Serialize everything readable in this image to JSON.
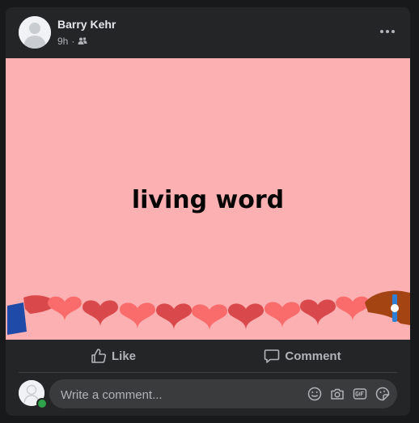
{
  "post": {
    "author": "Barry Kehr",
    "time": "9h",
    "separator": "·",
    "audience_icon": "friends-icon",
    "more_icon": "more-options-icon"
  },
  "banner": {
    "text": "living word",
    "background": "#fcb0b2"
  },
  "actions": {
    "like_label": "Like",
    "comment_label": "Comment"
  },
  "composer": {
    "placeholder": "Write a comment...",
    "tools": [
      "emoji-icon",
      "camera-icon",
      "gif-icon",
      "sticker-icon"
    ]
  }
}
